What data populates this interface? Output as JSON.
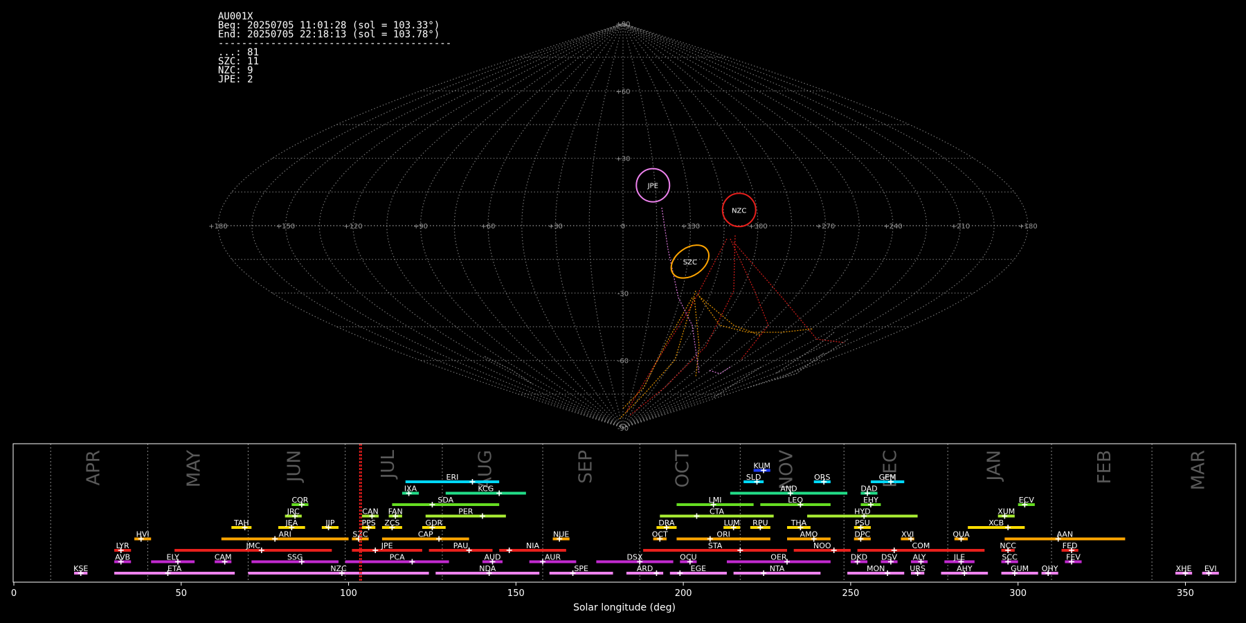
{
  "info_panel": {
    "lines": [
      "AU001X",
      "Beg: 20250705 11:01:28 (sol = 103.33°)",
      "End: 20250705 22:18:13 (sol = 103.78°)",
      "----------------------------------------",
      "...: 81",
      "SZC: 11",
      "NZC: 9",
      "JPE: 2"
    ]
  },
  "sky_map": {
    "projection": "sinusoidal",
    "lon_labels": [
      "+180",
      "+150",
      "+120",
      "+90",
      "+60",
      "+30",
      "0",
      "+330",
      "+300",
      "+270",
      "+240",
      "+210",
      "+180"
    ],
    "lat_labels": [
      "+90",
      "+60",
      "+30",
      "-30",
      "-60",
      "-90"
    ],
    "radiants": [
      {
        "name": "JPE",
        "lon": 346,
        "lat": 18,
        "color": "#ee82ee"
      },
      {
        "name": "NZC",
        "lon": 308,
        "lat": 7,
        "color": "#e8201c"
      },
      {
        "name": "SZC",
        "lon": 329,
        "lat": -16,
        "color": "#ffa500"
      }
    ]
  },
  "chart_data": {
    "type": "timeline",
    "xlabel": "Solar longitude (deg)",
    "xlim": [
      0,
      365
    ],
    "x_ticks": [
      0,
      50,
      100,
      150,
      200,
      250,
      300,
      350
    ],
    "current_sol": [
      103.33,
      103.78
    ],
    "months": [
      {
        "name": "APR",
        "sol": 24
      },
      {
        "name": "MAY",
        "sol": 54
      },
      {
        "name": "JUN",
        "sol": 84
      },
      {
        "name": "JUL",
        "sol": 112
      },
      {
        "name": "AUG",
        "sol": 141
      },
      {
        "name": "SEP",
        "sol": 171
      },
      {
        "name": "OCT",
        "sol": 200
      },
      {
        "name": "NOV",
        "sol": 231
      },
      {
        "name": "DEC",
        "sol": 262
      },
      {
        "name": "JAN",
        "sol": 293
      },
      {
        "name": "FEB",
        "sol": 326
      },
      {
        "name": "MAR",
        "sol": 354
      }
    ],
    "month_boundaries": [
      11,
      40,
      70,
      99,
      128,
      158,
      187,
      217,
      248,
      279,
      310,
      340
    ],
    "showers": [
      {
        "code": "KUM",
        "start": 221,
        "end": 226,
        "peak": 224,
        "row": 10,
        "color": "#1e3cff"
      },
      {
        "code": "ERI",
        "start": 117,
        "end": 145,
        "peak": 137,
        "row": 9,
        "color": "#00d8ff"
      },
      {
        "code": "SLD",
        "start": 218,
        "end": 224,
        "peak": 222,
        "row": 9,
        "color": "#00d8ff"
      },
      {
        "code": "ORS",
        "start": 239,
        "end": 244,
        "peak": 242,
        "row": 9,
        "color": "#00d8ff"
      },
      {
        "code": "GEM",
        "start": 256,
        "end": 266,
        "peak": 262,
        "row": 9,
        "color": "#00d8ff"
      },
      {
        "code": "IXA",
        "start": 116,
        "end": 121,
        "peak": 118,
        "row": 8,
        "color": "#22dd88"
      },
      {
        "code": "KCG",
        "start": 129,
        "end": 153,
        "peak": 145,
        "row": 8,
        "color": "#22dd88"
      },
      {
        "code": "AND",
        "start": 214,
        "end": 249,
        "peak": 232,
        "row": 8,
        "color": "#22dd88"
      },
      {
        "code": "DAD",
        "start": 253,
        "end": 258,
        "peak": 255,
        "row": 8,
        "color": "#22dd88"
      },
      {
        "code": "COR",
        "start": 83,
        "end": 88,
        "peak": 86,
        "row": 7,
        "color": "#66dd22"
      },
      {
        "code": "SDA",
        "start": 113,
        "end": 145,
        "peak": 125,
        "row": 7,
        "color": "#66dd22"
      },
      {
        "code": "LMI",
        "start": 198,
        "end": 221,
        "peak": 209,
        "row": 7,
        "color": "#66dd22"
      },
      {
        "code": "LEO",
        "start": 223,
        "end": 244,
        "peak": 235,
        "row": 7,
        "color": "#66dd22"
      },
      {
        "code": "EHY",
        "start": 253,
        "end": 259,
        "peak": 256,
        "row": 7,
        "color": "#66dd22"
      },
      {
        "code": "ECV",
        "start": 300,
        "end": 305,
        "peak": 302,
        "row": 7,
        "color": "#66dd22"
      },
      {
        "code": "JRC",
        "start": 81,
        "end": 86,
        "peak": 84,
        "row": 6,
        "color": "#aaee33"
      },
      {
        "code": "CAN",
        "start": 104,
        "end": 109,
        "peak": 107,
        "row": 6,
        "color": "#aaee33"
      },
      {
        "code": "FAN",
        "start": 112,
        "end": 116,
        "peak": 114,
        "row": 6,
        "color": "#aaee33"
      },
      {
        "code": "PER",
        "start": 123,
        "end": 147,
        "peak": 140,
        "row": 6,
        "color": "#aaee33"
      },
      {
        "code": "CTA",
        "start": 193,
        "end": 227,
        "peak": 204,
        "row": 6,
        "color": "#aaee33"
      },
      {
        "code": "HYD",
        "start": 237,
        "end": 270,
        "peak": 254,
        "row": 6,
        "color": "#aaee33"
      },
      {
        "code": "XUM",
        "start": 294,
        "end": 299,
        "peak": 296,
        "row": 6,
        "color": "#aaee33"
      },
      {
        "code": "TAH",
        "start": 65,
        "end": 71,
        "peak": 69,
        "row": 5,
        "color": "#ffdd00"
      },
      {
        "code": "JEA",
        "start": 79,
        "end": 87,
        "peak": 83,
        "row": 5,
        "color": "#ffdd00"
      },
      {
        "code": "JIP",
        "start": 92,
        "end": 97,
        "peak": 94,
        "row": 5,
        "color": "#ffdd00"
      },
      {
        "code": "PPS",
        "start": 104,
        "end": 108,
        "peak": 106,
        "row": 5,
        "color": "#ffdd00"
      },
      {
        "code": "ZCS",
        "start": 110,
        "end": 116,
        "peak": 113,
        "row": 5,
        "color": "#ffdd00"
      },
      {
        "code": "GDR",
        "start": 122,
        "end": 129,
        "peak": 125,
        "row": 5,
        "color": "#ffdd00"
      },
      {
        "code": "DRA",
        "start": 192,
        "end": 198,
        "peak": 195,
        "row": 5,
        "color": "#ffdd00"
      },
      {
        "code": "LUM",
        "start": 212,
        "end": 217,
        "peak": 215,
        "row": 5,
        "color": "#ffdd00"
      },
      {
        "code": "RPU",
        "start": 220,
        "end": 226,
        "peak": 223,
        "row": 5,
        "color": "#ffdd00"
      },
      {
        "code": "THA",
        "start": 231,
        "end": 238,
        "peak": 235,
        "row": 5,
        "color": "#ffdd00"
      },
      {
        "code": "PSU",
        "start": 251,
        "end": 256,
        "peak": 253,
        "row": 5,
        "color": "#ffdd00"
      },
      {
        "code": "XCB",
        "start": 285,
        "end": 302,
        "peak": 297,
        "row": 5,
        "color": "#ffdd00"
      },
      {
        "code": "HVI",
        "start": 36,
        "end": 41,
        "peak": 38,
        "row": 4,
        "color": "#ffa500"
      },
      {
        "code": "ARI",
        "start": 62,
        "end": 100,
        "peak": 78,
        "row": 4,
        "color": "#ffa500"
      },
      {
        "code": "SZC",
        "start": 101,
        "end": 106,
        "peak": 103,
        "row": 4,
        "color": "#ffa500"
      },
      {
        "code": "CAP",
        "start": 110,
        "end": 136,
        "peak": 127,
        "row": 4,
        "color": "#ffa500"
      },
      {
        "code": "NUE",
        "start": 161,
        "end": 166,
        "peak": 163,
        "row": 4,
        "color": "#ffa500"
      },
      {
        "code": "OCT",
        "start": 191,
        "end": 195,
        "peak": 193,
        "row": 4,
        "color": "#ffa500"
      },
      {
        "code": "ORI",
        "start": 198,
        "end": 226,
        "peak": 208,
        "row": 4,
        "color": "#ffa500"
      },
      {
        "code": "AMO",
        "start": 231,
        "end": 244,
        "peak": 239,
        "row": 4,
        "color": "#ffa500"
      },
      {
        "code": "DPC",
        "start": 251,
        "end": 256,
        "peak": 253,
        "row": 4,
        "color": "#ffa500"
      },
      {
        "code": "XVI",
        "start": 265,
        "end": 269,
        "peak": 268,
        "row": 4,
        "color": "#ffa500"
      },
      {
        "code": "QUA",
        "start": 281,
        "end": 285,
        "peak": 283,
        "row": 4,
        "color": "#ffa500"
      },
      {
        "code": "AAN",
        "start": 296,
        "end": 332,
        "peak": 312,
        "row": 4,
        "color": "#ffa500"
      },
      {
        "code": "LYR",
        "start": 30,
        "end": 35,
        "peak": 32,
        "row": 3,
        "color": "#e8201c"
      },
      {
        "code": "JMC",
        "start": 48,
        "end": 95,
        "peak": 74,
        "row": 3,
        "color": "#e8201c"
      },
      {
        "code": "JPE",
        "start": 101,
        "end": 122,
        "peak": 108,
        "row": 3,
        "color": "#e8201c"
      },
      {
        "code": "PAU",
        "start": 124,
        "end": 143,
        "peak": 136,
        "row": 3,
        "color": "#e8201c"
      },
      {
        "code": "NIA",
        "start": 145,
        "end": 165,
        "peak": 148,
        "row": 3,
        "color": "#e8201c"
      },
      {
        "code": "STA",
        "start": 188,
        "end": 231,
        "peak": 217,
        "row": 3,
        "color": "#e8201c"
      },
      {
        "code": "NOO",
        "start": 233,
        "end": 250,
        "peak": 245,
        "row": 3,
        "color": "#e8201c"
      },
      {
        "code": "COM",
        "start": 252,
        "end": 290,
        "peak": 263,
        "row": 3,
        "color": "#e8201c"
      },
      {
        "code": "NCC",
        "start": 295,
        "end": 299,
        "peak": 297,
        "row": 3,
        "color": "#e8201c"
      },
      {
        "code": "FED",
        "start": 313,
        "end": 318,
        "peak": 316,
        "row": 3,
        "color": "#e8201c"
      },
      {
        "code": "AVB",
        "start": 30,
        "end": 35,
        "peak": 32,
        "row": 2,
        "color": "#c22ad0"
      },
      {
        "code": "ELY",
        "start": 41,
        "end": 54,
        "peak": 49,
        "row": 2,
        "color": "#c22ad0"
      },
      {
        "code": "CAM",
        "start": 60,
        "end": 65,
        "peak": 63,
        "row": 2,
        "color": "#c22ad0"
      },
      {
        "code": "SSG",
        "start": 71,
        "end": 97,
        "peak": 86,
        "row": 2,
        "color": "#c22ad0"
      },
      {
        "code": "PCA",
        "start": 99,
        "end": 130,
        "peak": 119,
        "row": 2,
        "color": "#c22ad0"
      },
      {
        "code": "AUD",
        "start": 140,
        "end": 146,
        "peak": 143,
        "row": 2,
        "color": "#c22ad0"
      },
      {
        "code": "AUR",
        "start": 154,
        "end": 168,
        "peak": 158,
        "row": 2,
        "color": "#c22ad0"
      },
      {
        "code": "DSX",
        "start": 174,
        "end": 197,
        "peak": 187,
        "row": 2,
        "color": "#c22ad0"
      },
      {
        "code": "OCU",
        "start": 199,
        "end": 204,
        "peak": 202,
        "row": 2,
        "color": "#c22ad0"
      },
      {
        "code": "OER",
        "start": 213,
        "end": 244,
        "peak": 231,
        "row": 2,
        "color": "#c22ad0"
      },
      {
        "code": "DKD",
        "start": 250,
        "end": 255,
        "peak": 252,
        "row": 2,
        "color": "#c22ad0"
      },
      {
        "code": "DSV",
        "start": 259,
        "end": 264,
        "peak": 262,
        "row": 2,
        "color": "#c22ad0"
      },
      {
        "code": "ALY",
        "start": 268,
        "end": 273,
        "peak": 271,
        "row": 2,
        "color": "#c22ad0"
      },
      {
        "code": "JLE",
        "start": 278,
        "end": 287,
        "peak": 283,
        "row": 2,
        "color": "#c22ad0"
      },
      {
        "code": "SCC",
        "start": 295,
        "end": 300,
        "peak": 297,
        "row": 2,
        "color": "#c22ad0"
      },
      {
        "code": "FEV",
        "start": 314,
        "end": 319,
        "peak": 316,
        "row": 2,
        "color": "#c22ad0"
      },
      {
        "code": "KSE",
        "start": 18,
        "end": 22,
        "peak": 20,
        "row": 1,
        "color": "#ee82ee"
      },
      {
        "code": "ETA",
        "start": 30,
        "end": 66,
        "peak": 46,
        "row": 1,
        "color": "#ee82ee"
      },
      {
        "code": "NZC",
        "start": 70,
        "end": 124,
        "peak": 98,
        "row": 1,
        "color": "#ee82ee"
      },
      {
        "code": "NDA",
        "start": 126,
        "end": 157,
        "peak": 142,
        "row": 1,
        "color": "#ee82ee"
      },
      {
        "code": "SPE",
        "start": 160,
        "end": 179,
        "peak": 167,
        "row": 1,
        "color": "#ee82ee"
      },
      {
        "code": "ARD",
        "start": 183,
        "end": 194,
        "peak": 192,
        "row": 1,
        "color": "#ee82ee"
      },
      {
        "code": "EGE",
        "start": 196,
        "end": 213,
        "peak": 199,
        "row": 1,
        "color": "#ee82ee"
      },
      {
        "code": "NTA",
        "start": 215,
        "end": 241,
        "peak": 224,
        "row": 1,
        "color": "#ee82ee"
      },
      {
        "code": "MON",
        "start": 249,
        "end": 266,
        "peak": 261,
        "row": 1,
        "color": "#ee82ee"
      },
      {
        "code": "URS",
        "start": 268,
        "end": 272,
        "peak": 270,
        "row": 1,
        "color": "#ee82ee"
      },
      {
        "code": "AHY",
        "start": 277,
        "end": 291,
        "peak": 284,
        "row": 1,
        "color": "#ee82ee"
      },
      {
        "code": "GUM",
        "start": 295,
        "end": 306,
        "peak": 299,
        "row": 1,
        "color": "#ee82ee"
      },
      {
        "code": "OHY",
        "start": 307,
        "end": 312,
        "peak": 309,
        "row": 1,
        "color": "#ee82ee"
      },
      {
        "code": "XHE",
        "start": 347,
        "end": 352,
        "peak": 350,
        "row": 1,
        "color": "#ee82ee"
      },
      {
        "code": "EVI",
        "start": 355,
        "end": 360,
        "peak": 357,
        "row": 1,
        "color": "#ee82ee"
      }
    ]
  }
}
